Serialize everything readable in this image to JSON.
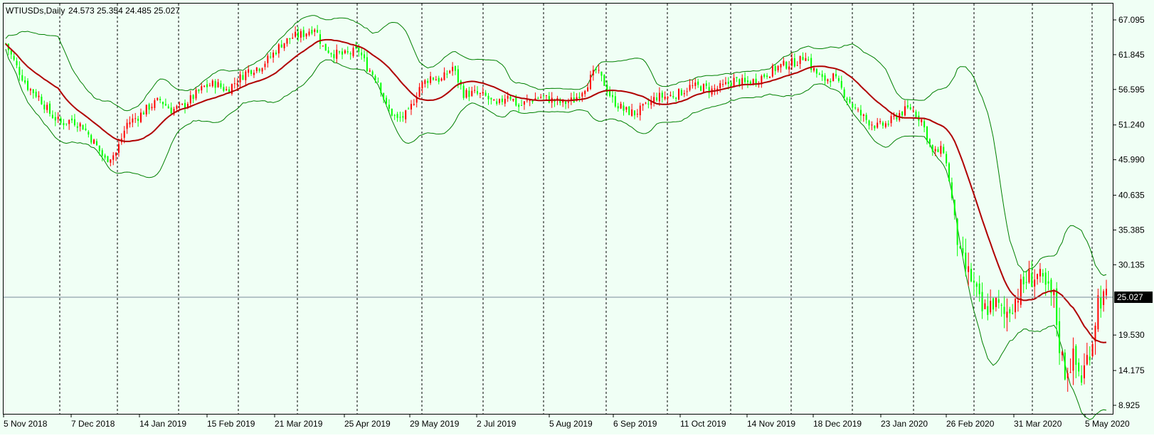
{
  "chart": {
    "symbol_timeframe": "WTIUSDs,Daily",
    "ohlc_readout": "24.573 25.354 24.485 25.027",
    "last_price_label": "25.027",
    "colors": {
      "background": "#f0fff5",
      "up_candle": "#ff0000",
      "down_candle": "#00ff00",
      "moving_average": "#b00000",
      "bands": "#008000",
      "grid": "#000000",
      "price_line": "#778899",
      "price_tag_bg": "#000000",
      "price_tag_text": "#ffffff"
    }
  },
  "chart_data": {
    "type": "candlestick",
    "title": "WTIUSDs,Daily",
    "ylim": [
      8.925,
      67.095
    ],
    "y_ticks": [
      "67.095",
      "61.845",
      "56.595",
      "51.240",
      "45.990",
      "40.635",
      "35.385",
      "30.135",
      "25.027",
      "19.530",
      "14.175",
      "8.925"
    ],
    "x_ticks": [
      "5 Nov 2018",
      "7 Dec 2018",
      "14 Jan 2019",
      "15 Feb 2019",
      "21 Mar 2019",
      "25 Apr 2019",
      "29 May 2019",
      "2 Jul 2019",
      "5 Aug 2019",
      "6 Sep 2019",
      "11 Oct 2019",
      "14 Nov 2019",
      "18 Dec 2019",
      "23 Jan 2020",
      "26 Feb 2020",
      "31 Mar 2020",
      "5 May 2020"
    ],
    "indicators": [
      "Moving Average (red)",
      "Bollinger Bands (green)"
    ],
    "last_price": 25.027,
    "close_path": [
      [
        0,
        63.5
      ],
      [
        4,
        60
      ],
      [
        8,
        57
      ],
      [
        12,
        55.5
      ],
      [
        16,
        53
      ],
      [
        20,
        51.5
      ],
      [
        24,
        52
      ],
      [
        28,
        51
      ],
      [
        33,
        48
      ],
      [
        36,
        46
      ],
      [
        40,
        47
      ],
      [
        44,
        51.5
      ],
      [
        48,
        52.5
      ],
      [
        52,
        54
      ],
      [
        56,
        55
      ],
      [
        60,
        53.5
      ],
      [
        64,
        54
      ],
      [
        68,
        55.5
      ],
      [
        72,
        57
      ],
      [
        76,
        57.5
      ],
      [
        80,
        56.5
      ],
      [
        84,
        58
      ],
      [
        88,
        59.5
      ],
      [
        92,
        60
      ],
      [
        96,
        61.5
      ],
      [
        100,
        63.5
      ],
      [
        104,
        64.5
      ],
      [
        108,
        65
      ],
      [
        112,
        66
      ],
      [
        115,
        63
      ],
      [
        119,
        62
      ],
      [
        123,
        61.8
      ],
      [
        128,
        62.5
      ],
      [
        131,
        60
      ],
      [
        135,
        58
      ],
      [
        138,
        54
      ],
      [
        142,
        52
      ],
      [
        146,
        53
      ],
      [
        150,
        57
      ],
      [
        154,
        58.5
      ],
      [
        158,
        58
      ],
      [
        162,
        60
      ],
      [
        166,
        56
      ],
      [
        170,
        56
      ],
      [
        174,
        55.5
      ],
      [
        178,
        54
      ],
      [
        182,
        56
      ],
      [
        186,
        54
      ],
      [
        190,
        55
      ],
      [
        194,
        55.5
      ],
      [
        198,
        55
      ],
      [
        202,
        54.5
      ],
      [
        206,
        55
      ],
      [
        210,
        57
      ],
      [
        214,
        59.5
      ],
      [
        217,
        57.5
      ],
      [
        220,
        55
      ],
      [
        224,
        53.5
      ],
      [
        228,
        53
      ],
      [
        232,
        54
      ],
      [
        236,
        55.5
      ],
      [
        240,
        55.5
      ],
      [
        244,
        56
      ],
      [
        248,
        57
      ],
      [
        252,
        57
      ],
      [
        256,
        56.5
      ],
      [
        260,
        57
      ],
      [
        264,
        58
      ],
      [
        268,
        57.5
      ],
      [
        272,
        58
      ],
      [
        276,
        59
      ],
      [
        280,
        60
      ],
      [
        284,
        60.5
      ],
      [
        288,
        61
      ],
      [
        290,
        62
      ],
      [
        292,
        60
      ],
      [
        296,
        58
      ],
      [
        300,
        58.5
      ],
      [
        304,
        56
      ],
      [
        308,
        53.5
      ],
      [
        312,
        52
      ],
      [
        316,
        51
      ],
      [
        320,
        51.5
      ],
      [
        324,
        53
      ],
      [
        328,
        53.8
      ],
      [
        332,
        52
      ],
      [
        336,
        47
      ],
      [
        340,
        47.5
      ],
      [
        342,
        43
      ],
      [
        346,
        31
      ],
      [
        350,
        28
      ],
      [
        354,
        23
      ],
      [
        358,
        24.5
      ],
      [
        362,
        22.5
      ],
      [
        366,
        25
      ],
      [
        370,
        28
      ],
      [
        374,
        28.5
      ],
      [
        376,
        27
      ],
      [
        380,
        25
      ],
      [
        382,
        18
      ],
      [
        384,
        14
      ],
      [
        387,
        16
      ],
      [
        390,
        13
      ],
      [
        392,
        16
      ],
      [
        394,
        19
      ],
      [
        396,
        25
      ],
      [
        398,
        25
      ]
    ]
  }
}
